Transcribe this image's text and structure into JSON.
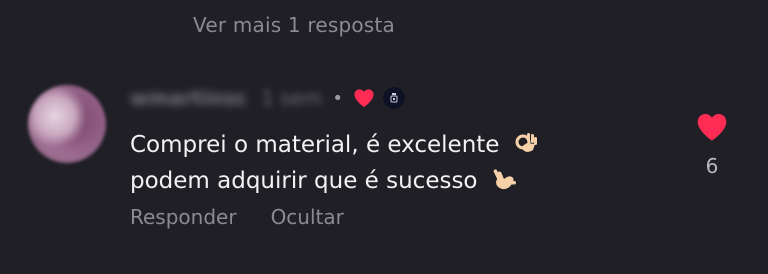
{
  "thread": {
    "view_more_label": "Ver mais 1 resposta"
  },
  "comment": {
    "username": "wmartinsc",
    "time": "1 sem",
    "separator": "•",
    "liked_by_author": true,
    "text_line_1": "Comprei o material, é excelente",
    "text_line_1_emoji": "ok-hand-icon",
    "text_line_2": "podem adquirir que é sucesso",
    "text_line_2_emoji": "call-me-hand-icon",
    "reply_label": "Responder",
    "hide_label": "Ocultar",
    "like_count": "6"
  },
  "colors": {
    "background": "#1f1f25",
    "heart": "#fe2c55",
    "text_primary": "#f2f2f4",
    "text_secondary": "#8a8a92"
  }
}
